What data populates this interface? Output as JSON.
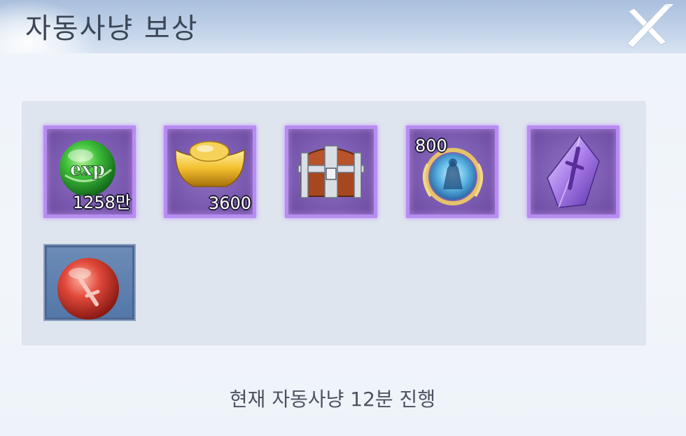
{
  "header": {
    "title": "자동사냥 보상"
  },
  "close": {
    "icon": "close-icon"
  },
  "rewards": {
    "items": [
      {
        "icon": "exp-orb-icon",
        "quantity": "1258만",
        "frame": "purple"
      },
      {
        "icon": "gold-ingot-icon",
        "quantity": "3600",
        "frame": "purple"
      },
      {
        "icon": "treasure-chest-icon",
        "quantity": "",
        "frame": "purple"
      },
      {
        "icon": "spirit-orb-icon",
        "quantity": "800",
        "frame": "purple"
      },
      {
        "icon": "purple-crystal-icon",
        "quantity": "",
        "frame": "purple"
      },
      {
        "icon": "red-sword-orb-icon",
        "quantity": "",
        "frame": "blue"
      }
    ]
  },
  "status": {
    "text": "현재 자동사냥 12분 진행"
  },
  "colors": {
    "header": "#b9cbe3",
    "panel": "#dee5ee",
    "purple_frame": "#b78df2",
    "blue_frame": "#5277a8",
    "title_text": "#3b4656",
    "status_text": "#4b5362"
  }
}
